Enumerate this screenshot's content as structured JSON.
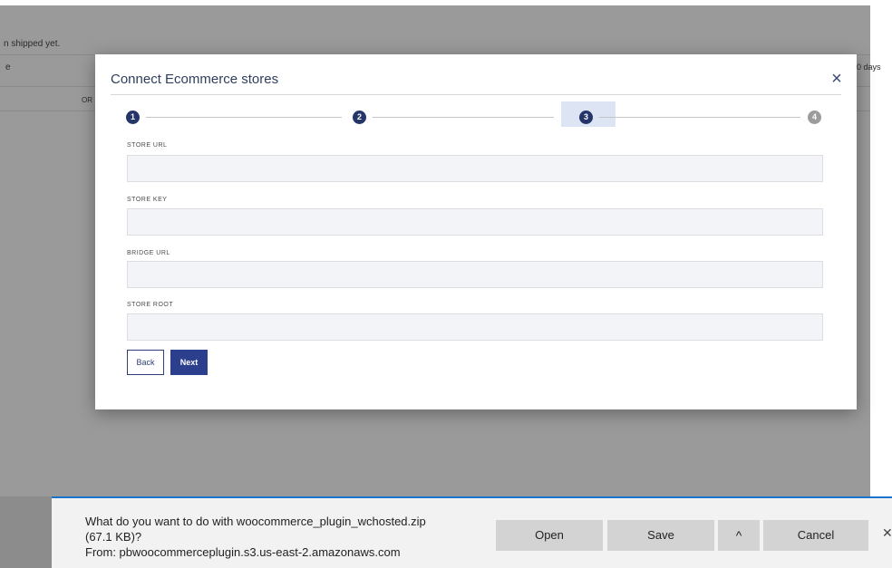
{
  "background": {
    "shipped_text": "n shipped yet.",
    "left_header": "e",
    "order_col": "OR",
    "days_col": "0 days"
  },
  "modal": {
    "title": "Connect Ecommerce stores",
    "close_icon": "close-icon",
    "steps": [
      {
        "number": "1",
        "state": "complete"
      },
      {
        "number": "2",
        "state": "complete"
      },
      {
        "number": "3",
        "state": "current"
      },
      {
        "number": "4",
        "state": "inactive"
      }
    ],
    "fields": [
      {
        "label": "STORE URL",
        "value": "",
        "placeholder": ""
      },
      {
        "label": "STORE KEY",
        "value": "",
        "placeholder": ""
      },
      {
        "label": "BRIDGE URL",
        "value": "",
        "placeholder": ""
      },
      {
        "label": "STORE ROOT",
        "value": "",
        "placeholder": ""
      }
    ],
    "back_label": "Back",
    "next_label": "Next",
    "accent_color": "#2c3f8c"
  },
  "download_bar": {
    "question_line1": "What do you want to do with woocommerce_plugin_wchosted.zip",
    "size": "(67.1 KB)?",
    "from": "From: pbwoocommerceplugin.s3.us-east-2.amazonaws.com",
    "open_label": "Open",
    "save_label": "Save",
    "save_menu_icon": "chevron-up-icon",
    "cancel_label": "Cancel",
    "close_icon": "close-icon",
    "accent_color": "#1a73c8"
  }
}
